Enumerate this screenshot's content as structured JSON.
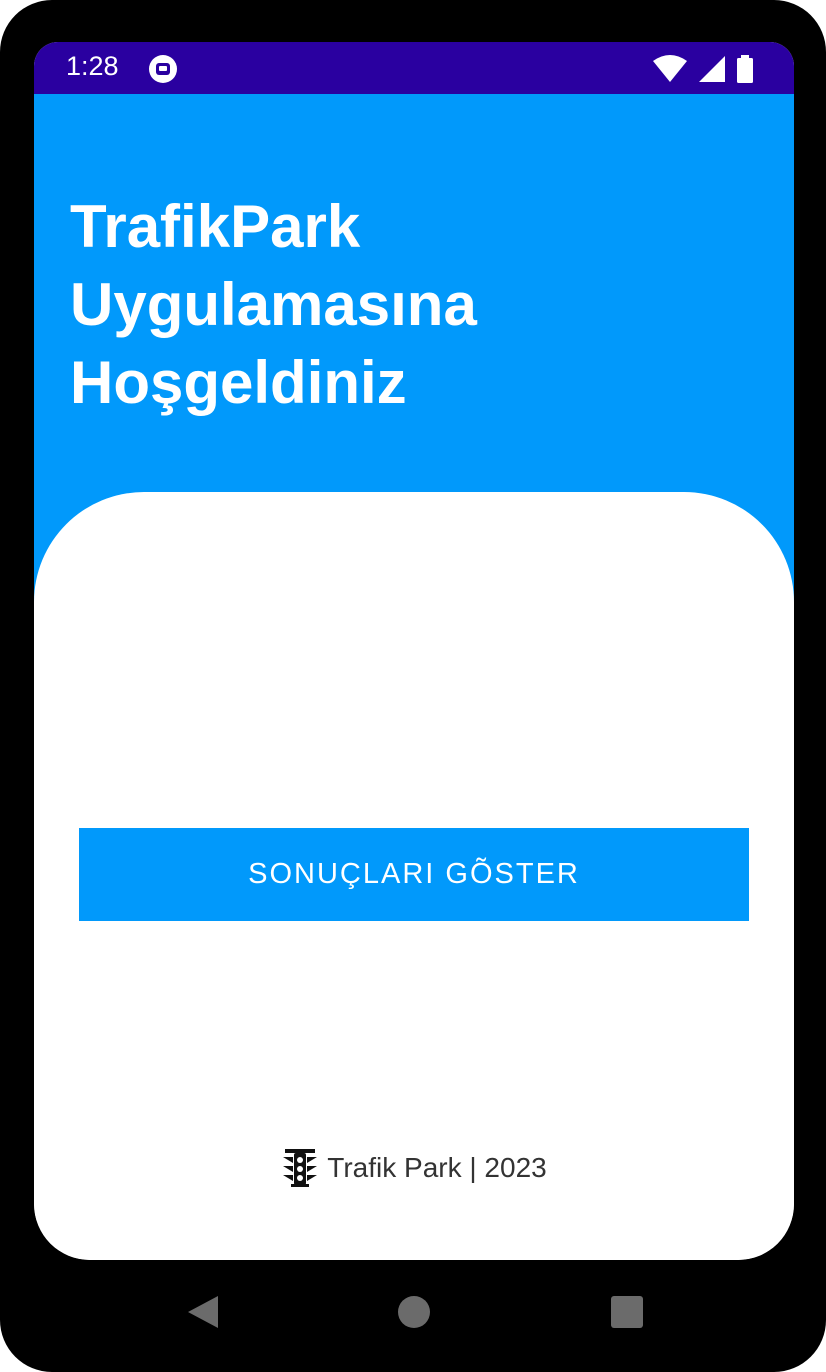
{
  "status_bar": {
    "time": "1:28",
    "icons": [
      "notification-icon",
      "wifi-icon",
      "signal-icon",
      "battery-icon"
    ],
    "background": "#2a00a0"
  },
  "welcome": {
    "lines": [
      "TrafikPark",
      "Uygulamasına",
      "Hoşgeldiniz"
    ]
  },
  "main": {
    "show_results_button": "SONUÇLARI GÕSTER"
  },
  "footer": {
    "logo_icon": "traffic-light-logo",
    "text": "Trafik Park | 2023"
  },
  "nav_bar": {
    "buttons": [
      "back",
      "home",
      "recents"
    ]
  },
  "colors": {
    "accent": "#0199fb",
    "status_bar": "#2a00a0",
    "card": "#ffffff",
    "device_frame": "#000000"
  }
}
